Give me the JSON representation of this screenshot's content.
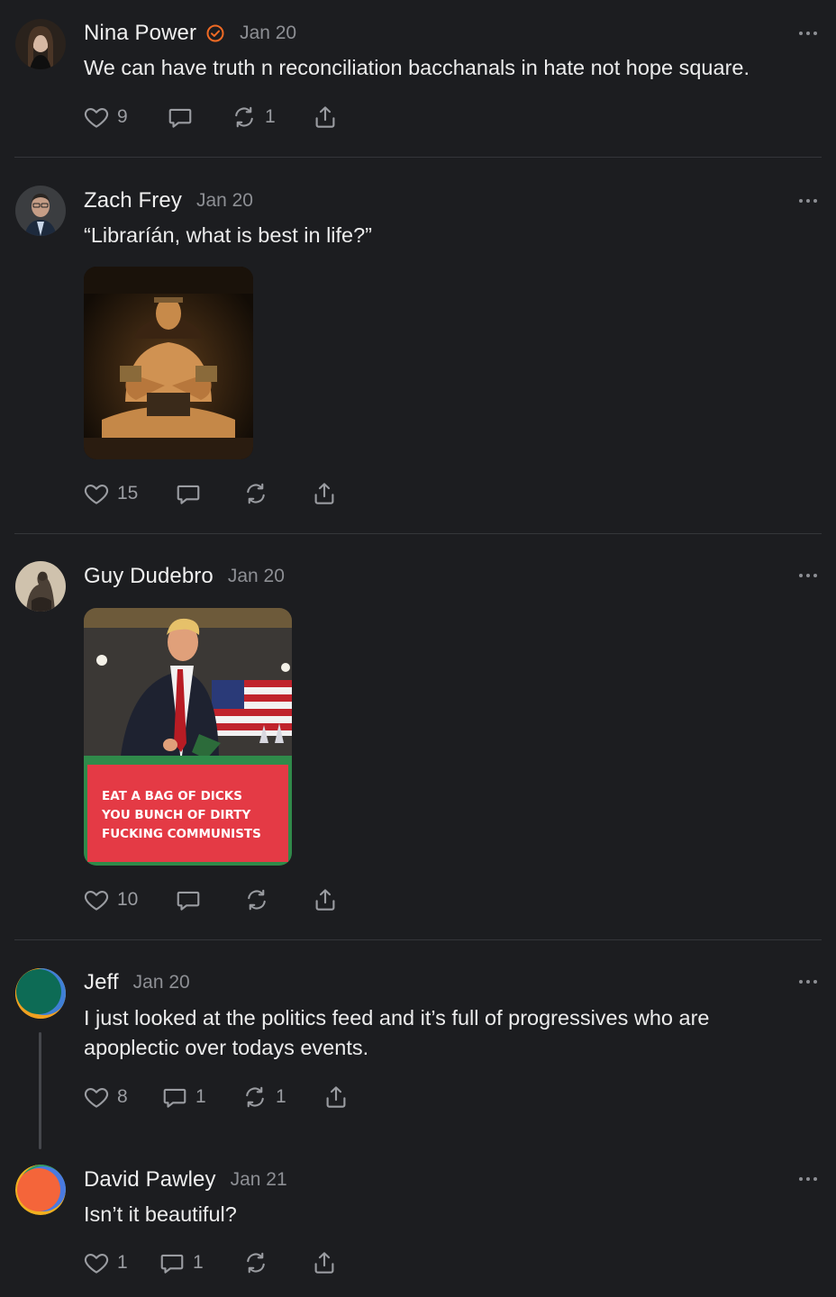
{
  "colors": {
    "background": "#1c1d20",
    "divider": "#34363a",
    "text": "#ececec",
    "muted": "#8d8f94",
    "verified": "#f06a24"
  },
  "posts": [
    {
      "name": "Nina Power",
      "verified": true,
      "date": "Jan 20",
      "text": "We can have truth n reconciliation bacchanals in hate not hope square.",
      "likes": "9",
      "comments": "",
      "restacks": "1",
      "icons": [
        "heart-icon",
        "comment-icon",
        "restack-icon",
        "share-icon"
      ]
    },
    {
      "name": "Zach Frey",
      "verified": false,
      "date": "Jan 20",
      "text": "“Libraríán, what is best in life?”",
      "likes": "15",
      "comments": "",
      "restacks": "",
      "image": "muscular-barbarian-photo"
    },
    {
      "name": "Guy Dudebro",
      "verified": false,
      "date": "Jan 20",
      "text": "",
      "likes": "10",
      "comments": "",
      "restacks": "",
      "image": "man-at-podium-meme",
      "image_caption": [
        "EAT A BAG OF DICKS",
        "YOU BUNCH OF DIRTY",
        "FUCKING COMMUNISTS"
      ]
    },
    {
      "name": "Jeff",
      "verified": false,
      "date": "Jan 20",
      "text_line1": "I just looked at the politics feed and it’s full of progressives who are",
      "text_line2": "apoplectic over todays events.",
      "likes": "8",
      "comments": "1",
      "restacks": "1"
    },
    {
      "name": "David Pawley",
      "verified": false,
      "date": "Jan 21",
      "text": "Isn’t it beautiful?",
      "likes": "1",
      "comments": "1",
      "restacks": ""
    }
  ]
}
